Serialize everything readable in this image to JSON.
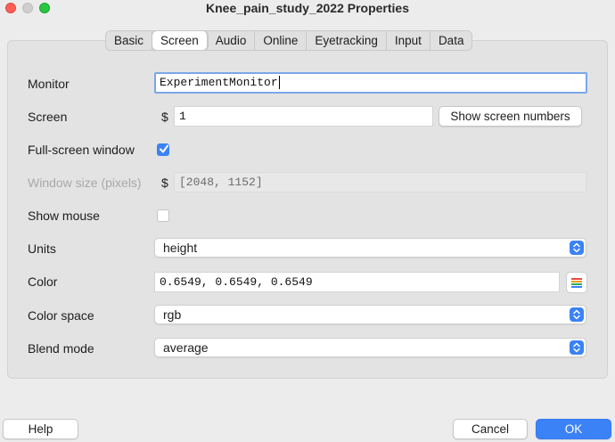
{
  "window": {
    "title": "Knee_pain_study_2022 Properties"
  },
  "tabs": [
    "Basic",
    "Screen",
    "Audio",
    "Online",
    "Eyetracking",
    "Input",
    "Data"
  ],
  "active_tab": "Screen",
  "form": {
    "monitor": {
      "label": "Monitor",
      "value": "ExperimentMonitor"
    },
    "screen": {
      "label": "Screen",
      "prefix": "$",
      "value": "1",
      "button": "Show screen numbers"
    },
    "fullscreen": {
      "label": "Full-screen window",
      "checked": true
    },
    "window_size": {
      "label": "Window size (pixels)",
      "prefix": "$",
      "value": "[2048, 1152]"
    },
    "show_mouse": {
      "label": "Show mouse",
      "checked": false
    },
    "units": {
      "label": "Units",
      "value": "height"
    },
    "color": {
      "label": "Color",
      "value": "0.6549, 0.6549, 0.6549"
    },
    "color_space": {
      "label": "Color space",
      "value": "rgb"
    },
    "blend_mode": {
      "label": "Blend mode",
      "value": "average"
    }
  },
  "footer": {
    "help": "Help",
    "cancel": "Cancel",
    "ok": "OK"
  },
  "colors": {
    "accent": "#3b82f6",
    "background": "#ececec"
  },
  "icons": [
    "close-window-icon",
    "minimize-window-icon",
    "zoom-window-icon",
    "checkmark-icon",
    "updown-arrows-icon",
    "color-palette-icon"
  ]
}
